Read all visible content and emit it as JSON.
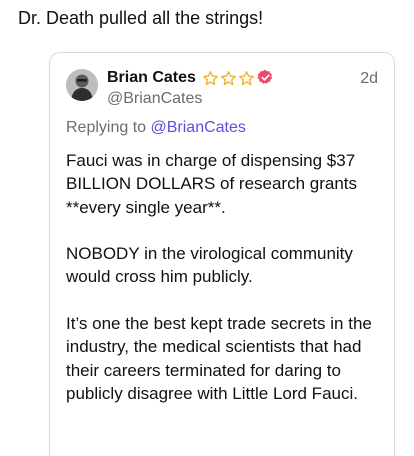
{
  "post": {
    "text": "Dr. Death pulled all the strings!"
  },
  "quote": {
    "author_name": "Brian Cates",
    "handle": "@BrianCates",
    "timestamp": "2d",
    "replying_prefix": "Replying to",
    "replying_handle": "@BrianCates",
    "star_icon": "star-outline-icon",
    "star_count": 3,
    "verified_icon": "verified-badge-icon",
    "colors": {
      "star": "#f2b230",
      "verified": "#f04a6a",
      "link": "#5a4fe0",
      "muted": "#6b6b75",
      "border": "#d9d9de"
    },
    "paragraphs": [
      "Fauci was in charge of dispensing $37 BILLION DOLLARS of research grants **every single year**.",
      "NOBODY in the virological community would cross him publicly.",
      "It’s one the best kept trade secrets in the industry, the medical scientists that had their careers terminated for daring to publicly disagree with Little Lord Fauci."
    ]
  }
}
